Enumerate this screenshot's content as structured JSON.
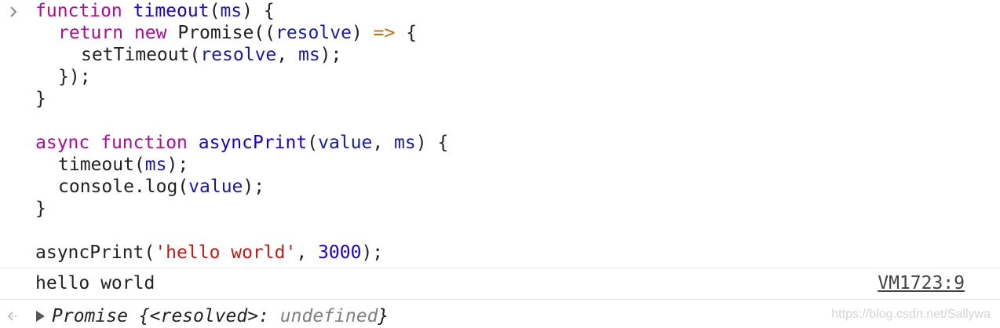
{
  "code": {
    "l1": {
      "a": "function",
      "b": "timeout",
      "c": "(",
      "d": "ms",
      "e": ") {"
    },
    "l2": {
      "a": "return",
      "b": "new",
      "c": "Promise((",
      "d": "resolve",
      "e": ")",
      "f": "=>",
      "g": "{"
    },
    "l3": {
      "a": "setTimeout(",
      "b": "resolve",
      "c": ", ",
      "d": "ms",
      "e": ");"
    },
    "l4": {
      "a": "});"
    },
    "l5": {
      "a": "}"
    },
    "l7": {
      "a": "async",
      "b": "function",
      "c": "asyncPrint",
      "d": "(",
      "e": "value",
      "f": ", ",
      "g": "ms",
      "h": ") {"
    },
    "l8": {
      "a": "timeout(",
      "b": "ms",
      "c": ");"
    },
    "l9": {
      "a": "console.log(",
      "b": "value",
      "c": ");"
    },
    "l10": {
      "a": "}"
    },
    "l12": {
      "a": "asyncPrint(",
      "b": "'hello world'",
      "c": ", ",
      "d": "3000",
      "e": ");"
    }
  },
  "log": {
    "message": "hello world",
    "source": "VM1723:9"
  },
  "result": {
    "prefix": "Promise {<resolved>: ",
    "value": "undefined",
    "suffix": "}"
  },
  "watermark": "https://blog.csdn.net/Sallywa",
  "icons": {
    "prompt": "chevron-right-icon",
    "result": "arrow-left-icon"
  },
  "colors": {
    "keyword": "#aa0d91",
    "function_name": "#1c00cf",
    "identifier": "#1a1aa6",
    "string": "#c41a16",
    "number": "#1c00cf",
    "arrow": "#c26b16"
  }
}
